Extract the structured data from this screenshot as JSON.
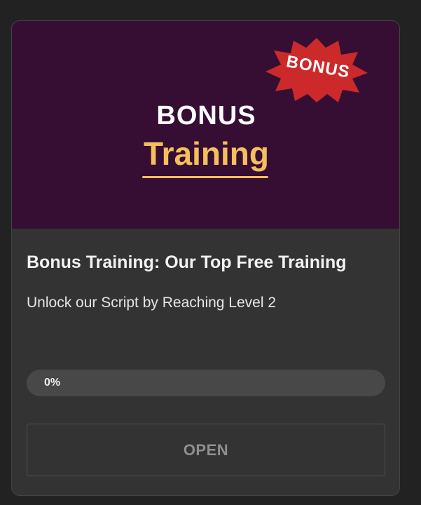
{
  "card": {
    "thumbnail": {
      "line1": "BONUS",
      "line2": "Training",
      "badge": "BONUS",
      "colors": {
        "background": "#360e33",
        "line1": "#ffffff",
        "line2": "#f4bf5c",
        "badge": "#cc2a2a"
      }
    },
    "title": "Bonus Training: Our Top Free Training",
    "subtitle": "Unlock our Script by Reaching Level 2",
    "progress": {
      "value": 0,
      "label": "0%"
    },
    "open_label": "OPEN"
  }
}
